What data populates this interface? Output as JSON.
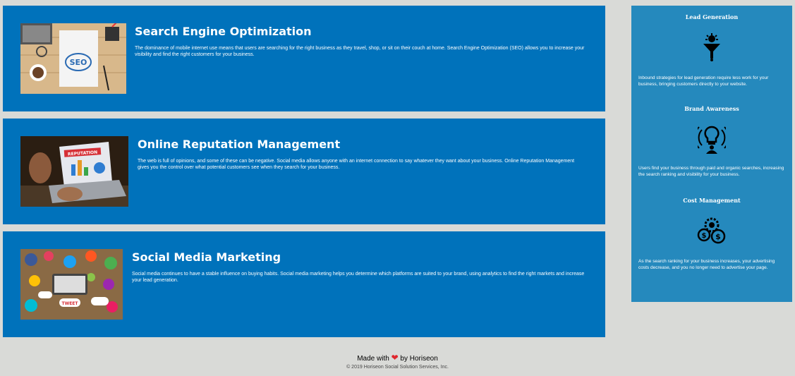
{
  "articles": [
    {
      "title": "Search Engine Optimization",
      "body": "The dominance of mobile internet use means that users are searching for the right business as they travel, shop, or sit on their couch at home. Search Engine Optimization (SEO) allows you to increase your visibility and find the right customers for your business.",
      "image": "seo-desk-photo",
      "image_text": "SEO"
    },
    {
      "title": "Online Reputation Management",
      "body": "The web is full of opinions, and some of these can be negative. Social media allows anyone with an internet connection to say whatever they want about your business. Online Reputation Management gives you the control over what potential customers see when they search for your business.",
      "image": "reputation-laptop-photo",
      "image_text": "REPUTATION"
    },
    {
      "title": "Social Media Marketing",
      "body": "Social media continues to have a stable influence on buying habits. Social media marketing helps you determine which platforms are suited to your brand, using analytics to find the right markets and increase your lead generation.",
      "image": "social-media-desk-photo",
      "image_text": "TWEET"
    }
  ],
  "benefits": [
    {
      "title": "Lead Generation",
      "icon": "lead-generation-funnel-icon",
      "body": "Inbound strategies for lead generation require less work for your business, bringing customers directly to your website."
    },
    {
      "title": "Brand Awareness",
      "icon": "brand-awareness-lightbulb-icon",
      "body": "Users find your business through paid and organic searches, increasing the search ranking and visibility for your business."
    },
    {
      "title": "Cost Management",
      "icon": "cost-management-coins-icon",
      "body": "As the search ranking for your business increases, your advertising costs decrease, and you no longer need to advertise your page."
    }
  ],
  "footer": {
    "made_with": "Made with",
    "by": "by Horiseon",
    "copyright": "© 2019 Horiseon Social Solution Services, Inc."
  },
  "colors": {
    "article_bg": "#0072bb",
    "aside_bg": "#2589bd",
    "page_bg": "#d9dad7",
    "heart": "#e0262d"
  }
}
